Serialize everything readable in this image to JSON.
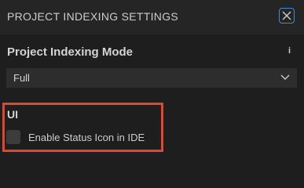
{
  "header": {
    "title": "PROJECT INDEXING SETTINGS",
    "close_icon": "close-icon"
  },
  "indexing_mode": {
    "label": "Project Indexing Mode",
    "info_icon_text": "i",
    "selected_value": "Full",
    "chevron_icon": "chevron-down-icon"
  },
  "ui_section": {
    "title": "UI",
    "checkbox_label": "Enable Status Icon in IDE",
    "checkbox_checked": false
  },
  "colors": {
    "background": "#1e1e1e",
    "header_bg": "#252526",
    "accent": "#3d8bd8",
    "highlight_border": "#e8432d"
  }
}
